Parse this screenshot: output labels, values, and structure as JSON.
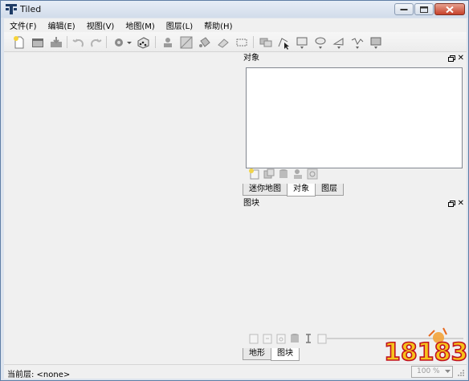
{
  "window": {
    "title": "Tiled"
  },
  "menu": [
    {
      "label": "文件(F)"
    },
    {
      "label": "编辑(E)"
    },
    {
      "label": "视图(V)"
    },
    {
      "label": "地图(M)"
    },
    {
      "label": "图层(L)"
    },
    {
      "label": "帮助(H)"
    }
  ],
  "objects_panel": {
    "title": "对象",
    "tabs": [
      {
        "label": "迷你地图"
      },
      {
        "label": "对象"
      },
      {
        "label": "图层"
      }
    ],
    "active_tab": "对象"
  },
  "tilesets_panel": {
    "title": "图块",
    "tabs": [
      {
        "label": "地形"
      },
      {
        "label": "图块"
      }
    ],
    "active_tab": "图块"
  },
  "status": {
    "current_layer": "当前层: <none>",
    "zoom": "100 %"
  },
  "watermark": {
    "text": "18183"
  },
  "icons": {
    "app": "tiled-app-icon",
    "minimize": "minimize-icon",
    "maximize": "maximize-icon",
    "close": "close-icon"
  }
}
